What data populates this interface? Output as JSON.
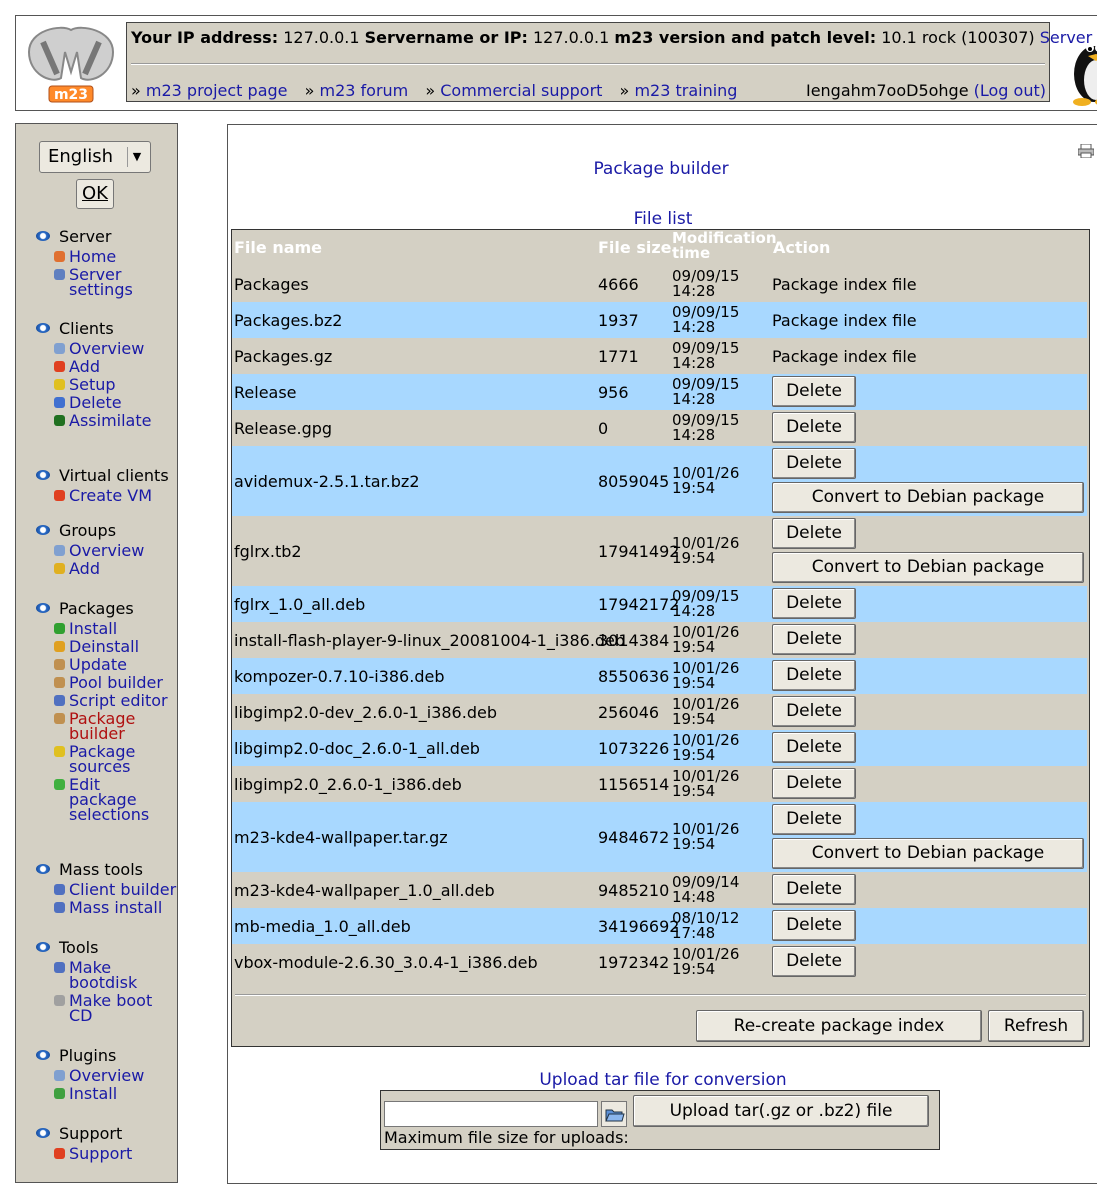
{
  "header": {
    "ip_label": "Your IP address:",
    "ip_value": "127.0.0.1",
    "server_label": "Servername or IP:",
    "server_value": "127.0.0.1",
    "version_label": "m23 version and patch level:",
    "version_value": "10.1 rock (100307)",
    "server_status": "Server status",
    "nav": [
      {
        "prefix": "»",
        "label": "m23 project page"
      },
      {
        "prefix": "»",
        "label": "m23 forum"
      },
      {
        "prefix": "»",
        "label": "Commercial support"
      },
      {
        "prefix": "»",
        "label": "m23 training"
      }
    ],
    "username": "Iengahm7ooD5ohge",
    "logout": "(Log out)",
    "logo_text": "m23"
  },
  "sidebar": {
    "language": "English",
    "ok_label": "OK",
    "groups": [
      {
        "title": "Server",
        "items": [
          {
            "label": "Home",
            "icon": "home-icon",
            "color": "#e07030"
          },
          {
            "label": "Server settings",
            "icon": "settings-icon",
            "color": "#6080c0"
          }
        ]
      },
      {
        "title": "Clients",
        "items": [
          {
            "label": "Overview",
            "icon": "magnifier-icon",
            "color": "#80a0d0"
          },
          {
            "label": "Add",
            "icon": "add-icon",
            "color": "#e04020"
          },
          {
            "label": "Setup",
            "icon": "setup-icon",
            "color": "#e0c020"
          },
          {
            "label": "Delete",
            "icon": "delete-icon",
            "color": "#4070d0"
          },
          {
            "label": "Assimilate",
            "icon": "assimilate-icon",
            "color": "#207020"
          }
        ]
      },
      {
        "title": "Virtual clients",
        "items": [
          {
            "label": "Create VM",
            "icon": "vm-icon",
            "color": "#e04020"
          }
        ]
      },
      {
        "title": "Groups",
        "items": [
          {
            "label": "Overview",
            "icon": "magnifier-icon",
            "color": "#80a0d0"
          },
          {
            "label": "Add",
            "icon": "star-icon",
            "color": "#e0b020"
          }
        ]
      },
      {
        "title": "Packages",
        "items": [
          {
            "label": "Install",
            "icon": "install-icon",
            "color": "#30a030"
          },
          {
            "label": "Deinstall",
            "icon": "deinstall-icon",
            "color": "#e0a020"
          },
          {
            "label": "Update",
            "icon": "update-icon",
            "color": "#c09050"
          },
          {
            "label": "Pool builder",
            "icon": "pool-icon",
            "color": "#c09050"
          },
          {
            "label": "Script editor",
            "icon": "script-icon",
            "color": "#5070c0"
          },
          {
            "label": "Package builder",
            "icon": "package-icon",
            "color": "#c09050",
            "active": true
          },
          {
            "label": "Package sources",
            "icon": "sources-icon",
            "color": "#e0c020"
          },
          {
            "label": "Edit package selections",
            "icon": "selections-icon",
            "color": "#40b040"
          }
        ]
      },
      {
        "title": "Mass tools",
        "items": [
          {
            "label": "Client builder",
            "icon": "client-builder-icon",
            "color": "#5070c0"
          },
          {
            "label": "Mass install",
            "icon": "mass-install-icon",
            "color": "#5070c0"
          }
        ]
      },
      {
        "title": "Tools",
        "items": [
          {
            "label": "Make bootdisk",
            "icon": "floppy-icon",
            "color": "#5070c0"
          },
          {
            "label": "Make boot CD",
            "icon": "cd-icon",
            "color": "#a0a0a0"
          }
        ]
      },
      {
        "title": "Plugins",
        "items": [
          {
            "label": "Overview",
            "icon": "magnifier-icon",
            "color": "#80a0d0"
          },
          {
            "label": "Install",
            "icon": "plugin-install-icon",
            "color": "#40a040"
          }
        ]
      },
      {
        "title": "Support",
        "items": [
          {
            "label": "Support",
            "icon": "lifebuoy-icon",
            "color": "#e04020"
          }
        ]
      }
    ]
  },
  "main": {
    "title": "Package builder",
    "filelist_caption": "File list",
    "columns": [
      "File name",
      "File size",
      "Modification time",
      "Action"
    ],
    "files": [
      {
        "name": "Packages",
        "size": "4666",
        "date": "09/09/15",
        "time": "14:28",
        "action": "Package index file"
      },
      {
        "name": "Packages.bz2",
        "size": "1937",
        "date": "09/09/15",
        "time": "14:28",
        "action": "Package index file"
      },
      {
        "name": "Packages.gz",
        "size": "1771",
        "date": "09/09/15",
        "time": "14:28",
        "action": "Package index file"
      },
      {
        "name": "Release",
        "size": "956",
        "date": "09/09/15",
        "time": "14:28",
        "delete": "Delete"
      },
      {
        "name": "Release.gpg",
        "size": "0",
        "date": "09/09/15",
        "time": "14:28",
        "delete": "Delete"
      },
      {
        "name": "avidemux-2.5.1.tar.bz2",
        "size": "8059045",
        "date": "10/01/26",
        "time": "19:54",
        "delete": "Delete",
        "convert": "Convert to Debian package"
      },
      {
        "name": "fglrx.tb2",
        "size": "17941492",
        "date": "10/01/26",
        "time": "19:54",
        "delete": "Delete",
        "convert": "Convert to Debian package"
      },
      {
        "name": "fglrx_1.0_all.deb",
        "size": "17942172",
        "date": "09/09/15",
        "time": "14:28",
        "delete": "Delete"
      },
      {
        "name": "install-flash-player-9-linux_20081004-1_i386.deb",
        "size": "3014384",
        "date": "10/01/26",
        "time": "19:54",
        "delete": "Delete"
      },
      {
        "name": "kompozer-0.7.10-i386.deb",
        "size": "8550636",
        "date": "10/01/26",
        "time": "19:54",
        "delete": "Delete"
      },
      {
        "name": "libgimp2.0-dev_2.6.0-1_i386.deb",
        "size": "256046",
        "date": "10/01/26",
        "time": "19:54",
        "delete": "Delete"
      },
      {
        "name": "libgimp2.0-doc_2.6.0-1_all.deb",
        "size": "1073226",
        "date": "10/01/26",
        "time": "19:54",
        "delete": "Delete"
      },
      {
        "name": "libgimp2.0_2.6.0-1_i386.deb",
        "size": "1156514",
        "date": "10/01/26",
        "time": "19:54",
        "delete": "Delete"
      },
      {
        "name": "m23-kde4-wallpaper.tar.gz",
        "size": "9484672",
        "date": "10/01/26",
        "time": "19:54",
        "delete": "Delete",
        "convert": "Convert to Debian package"
      },
      {
        "name": "m23-kde4-wallpaper_1.0_all.deb",
        "size": "9485210",
        "date": "09/09/14",
        "time": "14:48",
        "delete": "Delete"
      },
      {
        "name": "mb-media_1.0_all.deb",
        "size": "34196692",
        "date": "08/10/12",
        "time": "17:48",
        "delete": "Delete"
      },
      {
        "name": "vbox-module-2.6.30_3.0.4-1_i386.deb",
        "size": "1972342",
        "date": "10/01/26",
        "time": "19:54",
        "delete": "Delete"
      }
    ],
    "recreate_label": "Re-create package index",
    "refresh_label": "Refresh",
    "upload_caption": "Upload tar file for conversion",
    "upload_value": "",
    "upload_button": "Upload tar(.gz or .bz2) file",
    "max_size_label": "Maximum file size for uploads:"
  },
  "colors": {
    "panel": "#d4d0c4",
    "row_highlight": "#a8d8ff",
    "link": "#1a1aa6",
    "active_link": "#b01010"
  }
}
